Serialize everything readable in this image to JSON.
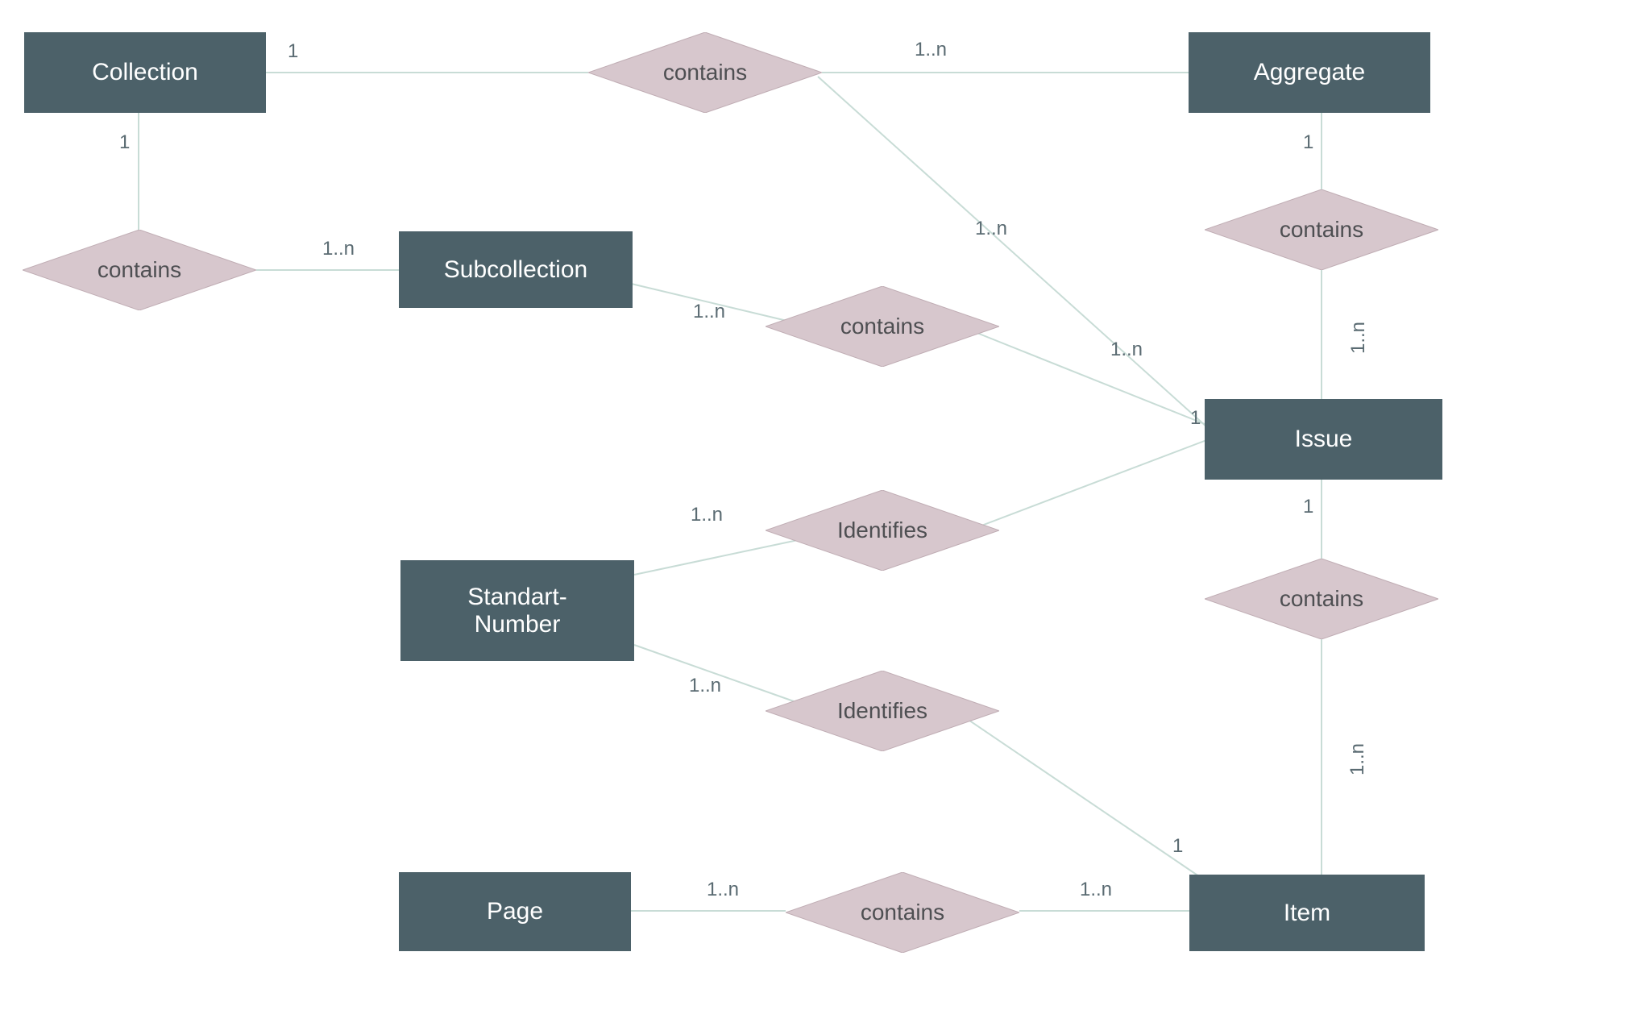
{
  "entities": {
    "collection": "Collection",
    "aggregate": "Aggregate",
    "subcollection": "Subcollection",
    "issue": "Issue",
    "standart_number_l1": "Standart-",
    "standart_number_l2": "Number",
    "page": "Page",
    "item": "Item"
  },
  "relations": {
    "contains": "contains",
    "identifies": "Identifies"
  },
  "cardinalities": {
    "one": "1",
    "one_n": "1..n"
  }
}
